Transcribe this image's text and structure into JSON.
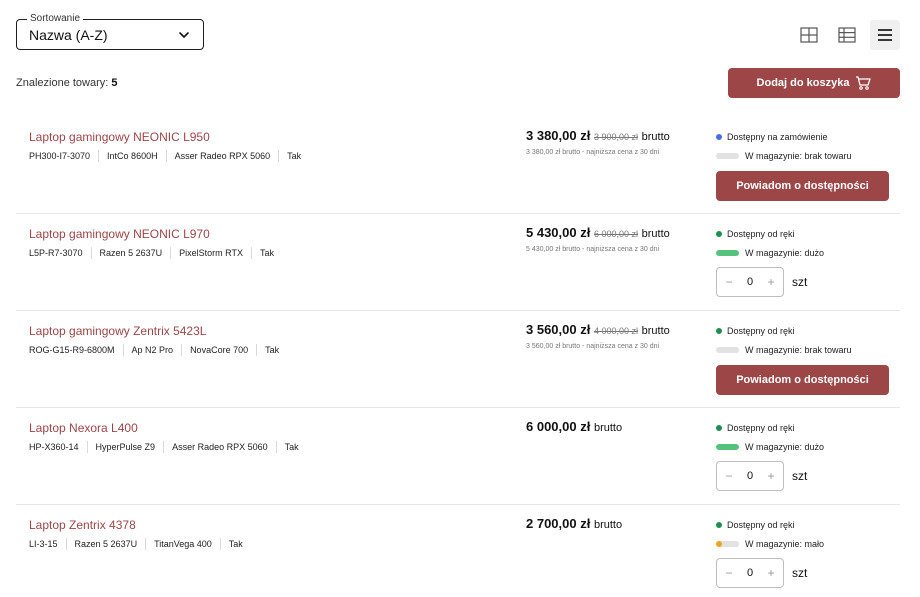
{
  "sort": {
    "legend": "Sortowanie",
    "value": "Nazwa (A-Z)"
  },
  "view_icons": [
    "grid-view-icon",
    "table-view-icon",
    "list-view-icon"
  ],
  "found": {
    "label": "Znalezione towary:",
    "count": "5"
  },
  "add_to_cart": {
    "label": "Dodaj do koszyka",
    "icon": "cart-icon"
  },
  "colors": {
    "accent": "#9c4648",
    "blue": "#4a6de5",
    "green": "#1f8f4e",
    "bar_green": "#53c27c",
    "orange": "#f0a21a"
  },
  "products": [
    {
      "name": "Laptop gamingowy NEONIC L950",
      "specs": [
        "PH300-I7-3070",
        "IntCo 8600H",
        "Asser Radeo RPX 5060",
        "Tak"
      ],
      "price": "3 380,00 zł",
      "old_price": "3 900,00 zł",
      "brutto": "brutto",
      "lowest": "3 380,00 zł brutto - najniższa cena z 30 dni",
      "availability": "Dostępny na zamówienie",
      "availability_color": "#4a6de5",
      "stock": "W magazynie: brak towaru",
      "stock_level": 0,
      "stock_color": "#e2e2e2",
      "action": "notify",
      "notify_label": "Powiadom o dostępności"
    },
    {
      "name": "Laptop gamingowy NEONIC L970",
      "specs": [
        "L5P-R7-3070",
        "Razen 5 2637U",
        "PixelStorm RTX",
        "Tak"
      ],
      "price": "5 430,00 zł",
      "old_price": "6 000,00 zł",
      "brutto": "brutto",
      "lowest": "5 430,00 zł brutto - najniższa cena z 30 dni",
      "availability": "Dostępny od ręki",
      "availability_color": "#1f8f4e",
      "stock": "W magazynie: dużo",
      "stock_level": 1,
      "stock_color": "#53c27c",
      "action": "qty",
      "qty": {
        "minus": "−",
        "value": "0",
        "plus": "+",
        "unit": "szt"
      }
    },
    {
      "name": "Laptop gamingowy Zentrix 5423L",
      "specs": [
        "ROG-G15-R9-6800M",
        "Ap N2 Pro",
        "NovaCore 700",
        "Tak"
      ],
      "price": "3 560,00 zł",
      "old_price": "4 000,00 zł",
      "brutto": "brutto",
      "lowest": "3 560,00 zł brutto - najniższa cena z 30 dni",
      "availability": "Dostępny od ręki",
      "availability_color": "#1f8f4e",
      "stock": "W magazynie: brak towaru",
      "stock_level": 0,
      "stock_color": "#e2e2e2",
      "action": "notify",
      "notify_label": "Powiadom o dostępności"
    },
    {
      "name": "Laptop Nexora L400",
      "specs": [
        "HP-X360-14",
        "HyperPulse Z9",
        "Asser Radeo RPX 5060",
        "Tak"
      ],
      "price": "6 000,00 zł",
      "old_price": "",
      "brutto": "brutto",
      "lowest": "",
      "availability": "Dostępny od ręki",
      "availability_color": "#1f8f4e",
      "stock": "W magazynie: dużo",
      "stock_level": 1,
      "stock_color": "#53c27c",
      "action": "qty",
      "qty": {
        "minus": "−",
        "value": "0",
        "plus": "+",
        "unit": "szt"
      }
    },
    {
      "name": "Laptop Zentrix 4378",
      "specs": [
        "LI-3-15",
        "Razen 5 2637U",
        "TitanVega 400",
        "Tak"
      ],
      "price": "2 700,00 zł",
      "old_price": "",
      "brutto": "brutto",
      "lowest": "",
      "availability": "Dostępny od ręki",
      "availability_color": "#1f8f4e",
      "stock": "W magazynie: mało",
      "stock_level": 0.25,
      "stock_color": "#f0a21a",
      "action": "qty",
      "qty": {
        "minus": "−",
        "value": "0",
        "plus": "+",
        "unit": "szt"
      }
    }
  ]
}
